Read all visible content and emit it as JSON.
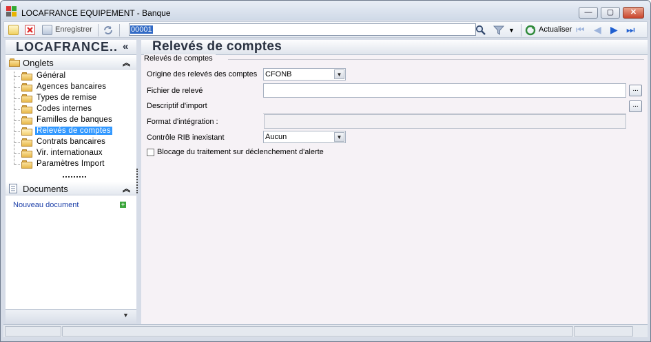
{
  "window": {
    "title": "LOCAFRANCE EQUIPEMENT -  Banque",
    "controls": {
      "minimize": "—",
      "maximize": "▢",
      "close": "✕"
    }
  },
  "toolbar": {
    "new_icon": "new-document-icon",
    "delete_icon": "delete-icon",
    "save_label": "Enregistrer",
    "refresh_icon": "refresh-icon",
    "search_value": "00001",
    "search_icon": "magnifier-icon",
    "filter_icon": "funnel-icon",
    "refresh_label": "Actualiser",
    "nav": {
      "first": "⏮",
      "prev": "◀",
      "next": "▶",
      "last": "⏭"
    }
  },
  "sidebar": {
    "brand": "LOCAFRANCE..",
    "brand_collapse": "«",
    "onglets_title": "Onglets",
    "onglets_chevron": "︽",
    "items": [
      {
        "label": "Général"
      },
      {
        "label": "Agences bancaires"
      },
      {
        "label": "Types de remise"
      },
      {
        "label": "Codes internes"
      },
      {
        "label": "Familles de banques"
      },
      {
        "label": "Relevés de comptes",
        "selected": true
      },
      {
        "label": "Contrats bancaires"
      },
      {
        "label": "Vir. internationaux"
      },
      {
        "label": "Paramètres Import"
      }
    ],
    "documents_title": "Documents",
    "documents_chevron": "︽",
    "new_document_label": "Nouveau document",
    "new_document_plus": "+",
    "bottom_chevron": "▼"
  },
  "main": {
    "title": "Relevés de comptes",
    "group_title": "Relevés de comptes",
    "fields": {
      "origine_label": "Origine des relevés des comptes",
      "origine_value": "CFONB",
      "fichier_label": "Fichier de relevé",
      "fichier_value": "",
      "descriptif_label": "Descriptif d'import",
      "descriptif_value": "",
      "format_label": "Format d'intégration :",
      "format_value": "",
      "controle_label": "Contrôle RIB inexistant",
      "controle_value": "Aucun",
      "blocage_label": "Blocage du traitement sur déclenchement d'alerte",
      "blocage_checked": false,
      "browse_label": "..."
    }
  },
  "colors": {
    "selection": "#3399ff",
    "link": "#1c3fa8",
    "accent_blue": "#1f5fd0"
  }
}
